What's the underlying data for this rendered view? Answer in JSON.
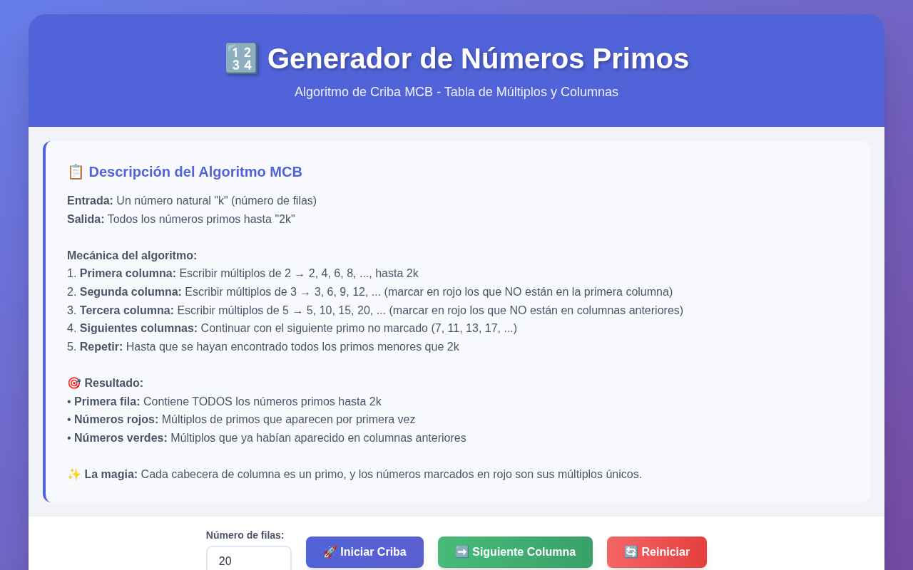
{
  "header": {
    "title": "🔢 Generador de Números Primos",
    "subtitle": "Algoritmo de Criba MCB - Tabla de Múltiplos y Columnas"
  },
  "description": {
    "title": "📋 Descripción del Algoritmo MCB",
    "paragraphs": [
      [
        "**Entrada:** Un número natural \"k\" (número de filas)",
        "**Salida:** Todos los números primos hasta \"2k\""
      ],
      [
        "**Mecánica del algoritmo:**",
        "1. **Primera columna:** Escribir múltiplos de 2 → 2, 4, 6, 8, ..., hasta 2k",
        "2. **Segunda columna:** Escribir múltiplos de 3 → 3, 6, 9, 12, ... (marcar en rojo los que NO están en la primera columna)",
        "3. **Tercera columna:** Escribir múltiplos de 5 → 5, 10, 15, 20, ... (marcar en rojo los que NO están en columnas anteriores)",
        "4. **Siguientes columnas:** Continuar con el siguiente primo no marcado (7, 11, 13, 17, ...)",
        "5. **Repetir:** Hasta que se hayan encontrado todos los primos menores que 2k"
      ],
      [
        "🎯 **Resultado:**",
        "• **Primera fila:** Contiene TODOS los números primos hasta 2k",
        "• **Números rojos:** Múltiplos de primos que aparecen por primera vez",
        "• **Números verdes:** Múltiplos que ya habían aparecido en columnas anteriores"
      ],
      [
        "✨ **La magia:** Cada cabecera de columna es un primo, y los números marcados en rojo son sus múltiplos únicos."
      ]
    ]
  },
  "controls": {
    "rows_label": "Número de filas:",
    "rows_value": "20",
    "buttons": [
      {
        "label": "🚀 Iniciar Criba",
        "kind": "start"
      },
      {
        "label": "➡️ Siguiente Columna",
        "kind": "next"
      },
      {
        "label": "🔄 Reiniciar",
        "kind": "reset"
      }
    ]
  }
}
